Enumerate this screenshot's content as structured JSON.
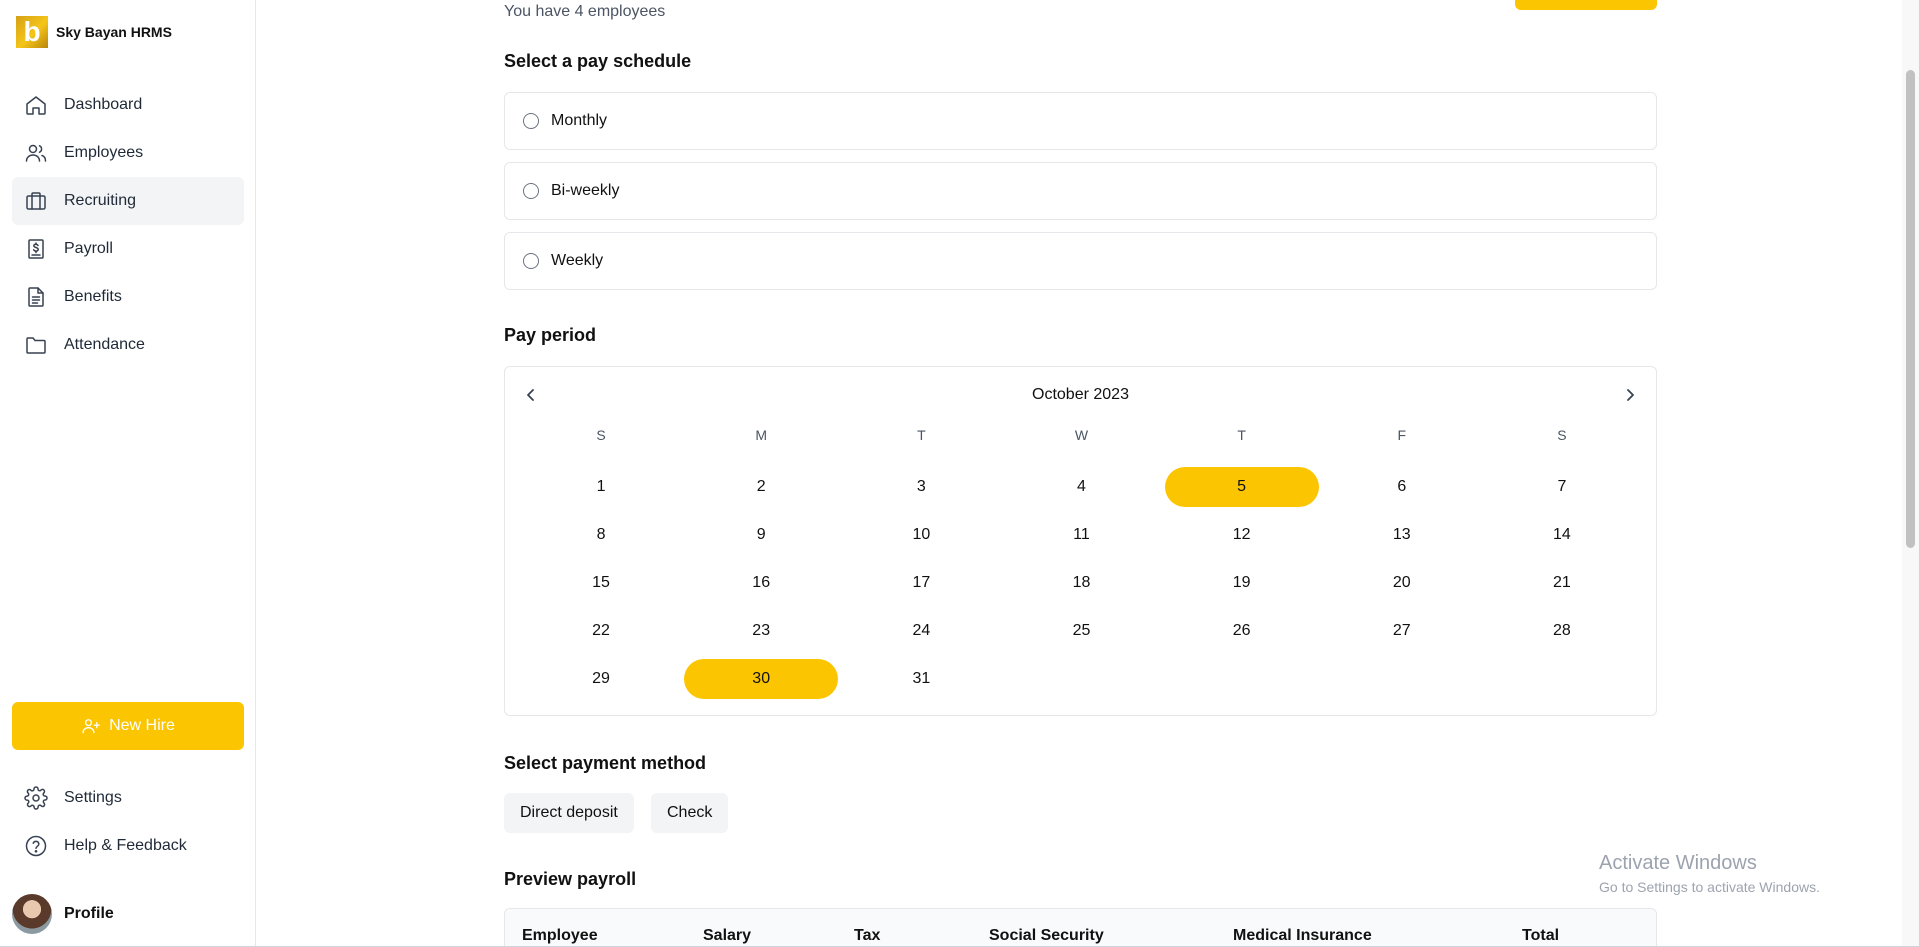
{
  "brand": {
    "name": "Sky Bayan HRMS",
    "logo_letter": "b"
  },
  "nav": [
    {
      "label": "Dashboard",
      "icon": "home-icon"
    },
    {
      "label": "Employees",
      "icon": "users-icon"
    },
    {
      "label": "Recruiting",
      "icon": "briefcase-icon",
      "active": true
    },
    {
      "label": "Payroll",
      "icon": "dollar-document-icon"
    },
    {
      "label": "Benefits",
      "icon": "document-icon"
    },
    {
      "label": "Attendance",
      "icon": "folder-icon"
    }
  ],
  "new_hire_label": "New Hire",
  "bottom_nav": [
    {
      "label": "Settings",
      "icon": "gear-icon"
    },
    {
      "label": "Help & Feedback",
      "icon": "help-circle-icon"
    }
  ],
  "profile_label": "Profile",
  "main": {
    "employee_count_text": "You have 4 employees",
    "pay_schedule_title": "Select a pay schedule",
    "pay_schedule_options": [
      "Monthly",
      "Bi-weekly",
      "Weekly"
    ],
    "pay_period_title": "Pay period",
    "calendar": {
      "month_label": "October 2023",
      "weekdays": [
        "S",
        "M",
        "T",
        "W",
        "T",
        "F",
        "S"
      ],
      "days": [
        1,
        2,
        3,
        4,
        5,
        6,
        7,
        8,
        9,
        10,
        11,
        12,
        13,
        14,
        15,
        16,
        17,
        18,
        19,
        20,
        21,
        22,
        23,
        24,
        25,
        26,
        27,
        28,
        29,
        30,
        31
      ],
      "first_weekday_index": 0,
      "selected_days": [
        5,
        30
      ]
    },
    "payment_method_title": "Select payment method",
    "payment_methods": [
      "Direct deposit",
      "Check"
    ],
    "preview_title": "Preview payroll",
    "preview_columns": [
      "Employee",
      "Salary",
      "Tax",
      "Social Security",
      "Medical Insurance",
      "Total"
    ]
  },
  "watermark": {
    "line1": "Activate Windows",
    "line2": "Go to Settings to activate Windows."
  },
  "colors": {
    "accent": "#fcc501",
    "border": "#e5e7eb",
    "active_bg": "#f3f4f6"
  }
}
